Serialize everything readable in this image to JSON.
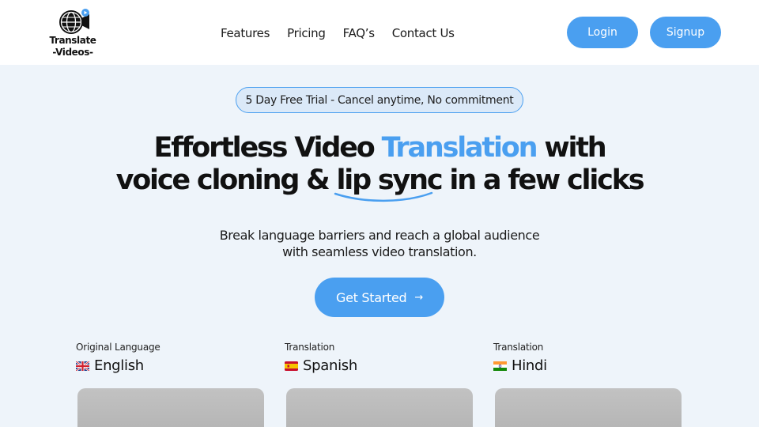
{
  "brand": {
    "logo_line1": "Translate",
    "logo_line2": "-Videos-",
    "accent_color": "#4a9ff0"
  },
  "nav": {
    "items": [
      {
        "label": "Features"
      },
      {
        "label": "Pricing"
      },
      {
        "label": "FAQ’s"
      },
      {
        "label": "Contact Us"
      }
    ],
    "login_label": "Login",
    "signup_label": "Signup"
  },
  "hero": {
    "badge": "5 Day Free Trial - Cancel anytime, No commitment",
    "headline_1_pre": "Effortless Video ",
    "headline_1_accent": "Translation",
    "headline_1_post": " with",
    "headline_2_pre": "voice cloning & ",
    "headline_2_underlined": "lip sync",
    "headline_2_post": " in a few clicks",
    "sub_1": "Break language barriers and reach a global audience",
    "sub_2": "with seamless video translation.",
    "cta_label": "Get Started",
    "cta_icon": "arrow-right-icon"
  },
  "languages": [
    {
      "caption": "Original Language",
      "name": "English",
      "flag": "uk-flag-icon"
    },
    {
      "caption": "Translation",
      "name": "Spanish",
      "flag": "spain-flag-icon"
    },
    {
      "caption": "Translation",
      "name": "Hindi",
      "flag": "india-flag-icon"
    }
  ]
}
